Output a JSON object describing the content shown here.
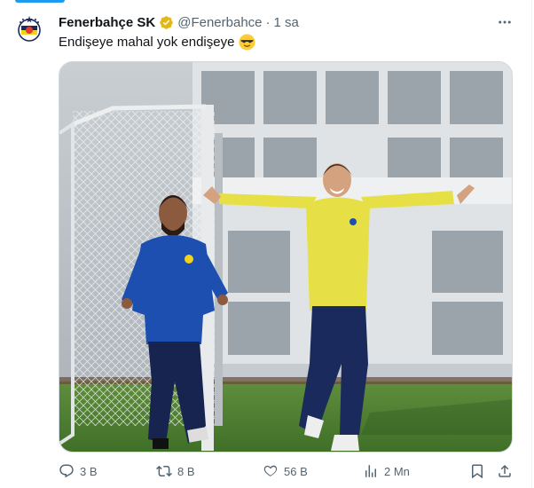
{
  "tweet": {
    "display_name": "Fenerbahçe SK",
    "handle": "@Fenerbahce",
    "separator": "·",
    "time": "1 sa",
    "text": "Endişeye mahal yok endişeye",
    "emoji": "smiling-face-with-sunglasses",
    "verified": "gold-verified-badge"
  },
  "actions": {
    "replies": "3 B",
    "retweets": "8 B",
    "likes": "56 B",
    "views": "2 Mn"
  },
  "colors": {
    "accent": "#1d9bf0",
    "verified_gold": "#e2b719",
    "secondary_text": "#536471",
    "jersey_yellow": "#e6e046",
    "jersey_blue": "#1c4fb0"
  }
}
